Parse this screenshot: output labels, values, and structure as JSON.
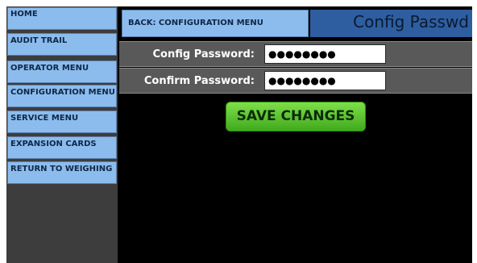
{
  "sidebar": {
    "items": [
      {
        "label": "HOME"
      },
      {
        "label": "AUDIT TRAIL"
      },
      {
        "label": "OPERATOR MENU"
      },
      {
        "label": "CONFIGURATION MENU"
      },
      {
        "label": "SERVICE MENU"
      },
      {
        "label": "EXPANSION CARDS"
      },
      {
        "label": "RETURN TO WEIGHING"
      }
    ]
  },
  "header": {
    "back_label": "BACK: CONFIGURATION MENU",
    "title": "Config Passwd"
  },
  "form": {
    "config_password": {
      "label": "Config Password:",
      "value": "●●●●●●●●"
    },
    "confirm_password": {
      "label": "Confirm Password:",
      "value": "●●●●●●●●"
    }
  },
  "actions": {
    "save_label": "SAVE CHANGES"
  },
  "colors": {
    "nav_button": "#8cbcee",
    "title_bar": "#2e5e9f",
    "save_button": "#4cbb24",
    "background": "#000000"
  }
}
